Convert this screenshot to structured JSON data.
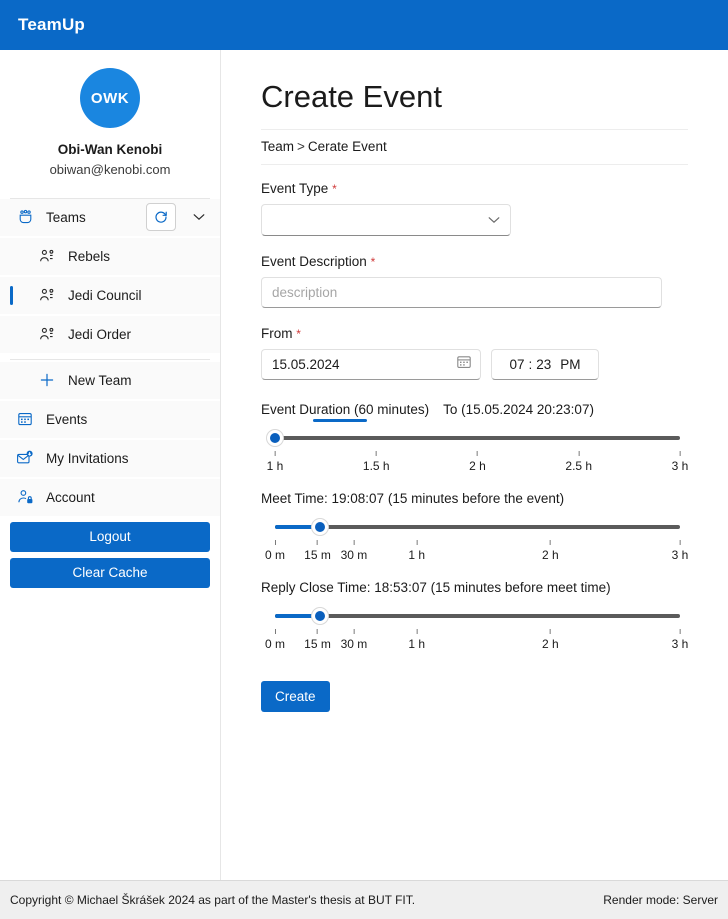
{
  "topbar": {
    "brand": "TeamUp"
  },
  "sidebar": {
    "profile": {
      "avatar_initials": "OWK",
      "name": "Obi-Wan Kenobi",
      "email": "obiwan@kenobi.com"
    },
    "teams_header": {
      "label": "Teams",
      "icon": "people-team-icon",
      "refresh_icon": "refresh-icon",
      "collapse_icon": "chevron-down-icon"
    },
    "teams": [
      {
        "label": "Rebels",
        "icon": "people-icon",
        "active": false
      },
      {
        "label": "Jedi Council",
        "icon": "people-icon",
        "active": true
      },
      {
        "label": "Jedi Order",
        "icon": "people-icon",
        "active": false
      }
    ],
    "new_team": {
      "label": "New Team",
      "icon": "plus-icon"
    },
    "nav": [
      {
        "label": "Events",
        "icon": "calendar-icon"
      },
      {
        "label": "My Invitations",
        "icon": "mail-inbox-icon"
      },
      {
        "label": "Account",
        "icon": "person-lock-icon"
      }
    ],
    "buttons": [
      {
        "label": "Logout",
        "name": "logout-button"
      },
      {
        "label": "Clear Cache",
        "name": "clear-cache-button"
      }
    ]
  },
  "main": {
    "title": "Create Event",
    "breadcrumb": {
      "root": "Team",
      "separator": ">",
      "current": "Cerate Event"
    },
    "event_type": {
      "label": "Event Type",
      "required": "*",
      "value": "",
      "chevron": "chevron-down-icon"
    },
    "event_description": {
      "label": "Event Description",
      "required": "*",
      "value": "",
      "placeholder": "description"
    },
    "from": {
      "label": "From",
      "required": "*",
      "date": "15.05.2024",
      "calendar_icon": "calendar-icon",
      "hour": "07",
      "colon": ":",
      "minute": "23",
      "meridiem": "PM"
    },
    "duration_slider": {
      "head_main": "Event Duration (60 minutes)",
      "head_to": "To (15.05.2024 20:23:07)",
      "value_pct": 0,
      "fill_pct": 0,
      "ticks": [
        {
          "label": "1 h",
          "pos_pct": 0
        },
        {
          "label": "1.5 h",
          "pos_pct": 25
        },
        {
          "label": "2 h",
          "pos_pct": 50
        },
        {
          "label": "2.5 h",
          "pos_pct": 75
        },
        {
          "label": "3 h",
          "pos_pct": 100
        }
      ]
    },
    "meet_slider": {
      "head_main": "Meet Time: 19:08:07 (15 minutes before the event)",
      "value_pct": 11,
      "fill_pct": 11,
      "ticks": [
        {
          "label": "0 m",
          "pos_pct": 0
        },
        {
          "label": "15 m",
          "pos_pct": 10.5
        },
        {
          "label": "30 m",
          "pos_pct": 19.5
        },
        {
          "label": "1 h",
          "pos_pct": 35
        },
        {
          "label": "2 h",
          "pos_pct": 68
        },
        {
          "label": "3 h",
          "pos_pct": 100
        }
      ]
    },
    "reply_slider": {
      "head_main": "Reply Close Time: 18:53:07 (15 minutes before meet time)",
      "value_pct": 11,
      "fill_pct": 11,
      "ticks": [
        {
          "label": "0 m",
          "pos_pct": 0
        },
        {
          "label": "15 m",
          "pos_pct": 10.5
        },
        {
          "label": "30 m",
          "pos_pct": 19.5
        },
        {
          "label": "1 h",
          "pos_pct": 35
        },
        {
          "label": "2 h",
          "pos_pct": 68
        },
        {
          "label": "3 h",
          "pos_pct": 100
        }
      ]
    },
    "create_button": "Create"
  },
  "footer": {
    "copyright": "Copyright © Michael Škrášek 2024 as part of the Master's thesis at BUT FIT.",
    "render_mode": "Render mode: Server"
  },
  "colors": {
    "brand_blue": "#0a69c7",
    "avatar_blue": "#1a86e0",
    "required_red": "#d03a3a",
    "track_gray": "#5b5b5b"
  }
}
